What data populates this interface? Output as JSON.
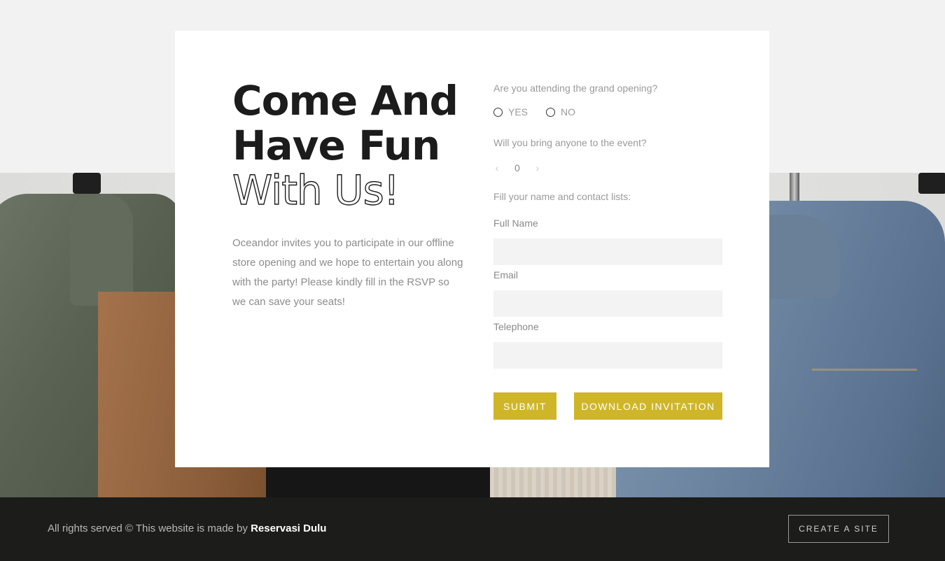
{
  "heading": {
    "line1": "Come And",
    "line2": "Have Fun",
    "line3": "With Us!"
  },
  "intro": "Oceandor invites you to participate in our offline store opening and we hope to entertain you along with the party! Please kindly fill in the RSVP so we can save your seats!",
  "form": {
    "attending_question": "Are you attending the grand opening?",
    "option_yes": "YES",
    "option_no": "NO",
    "guests_question": "Will you bring anyone to the event?",
    "guest_count": "0",
    "contact_prompt": "Fill your name and contact lists:",
    "full_name_label": "Full Name",
    "email_label": "Email",
    "telephone_label": "Telephone",
    "full_name_value": "",
    "email_value": "",
    "telephone_value": "",
    "submit_label": "SUBMIT",
    "download_label": "DOWNLOAD INVITATION"
  },
  "footer": {
    "copyright_prefix": "All rights served © This website is made by",
    "brand": "Reservasi Dulu",
    "create_site_label": "CREATE A SITE"
  },
  "colors": {
    "accent": "#cfb629",
    "footer_bg": "#1c1c1a",
    "heading": "#1c1c1c",
    "body_text": "#8c8c8c"
  },
  "icons": {
    "prev": "chevron-left-icon",
    "next": "chevron-right-icon",
    "radio": "radio-icon"
  }
}
